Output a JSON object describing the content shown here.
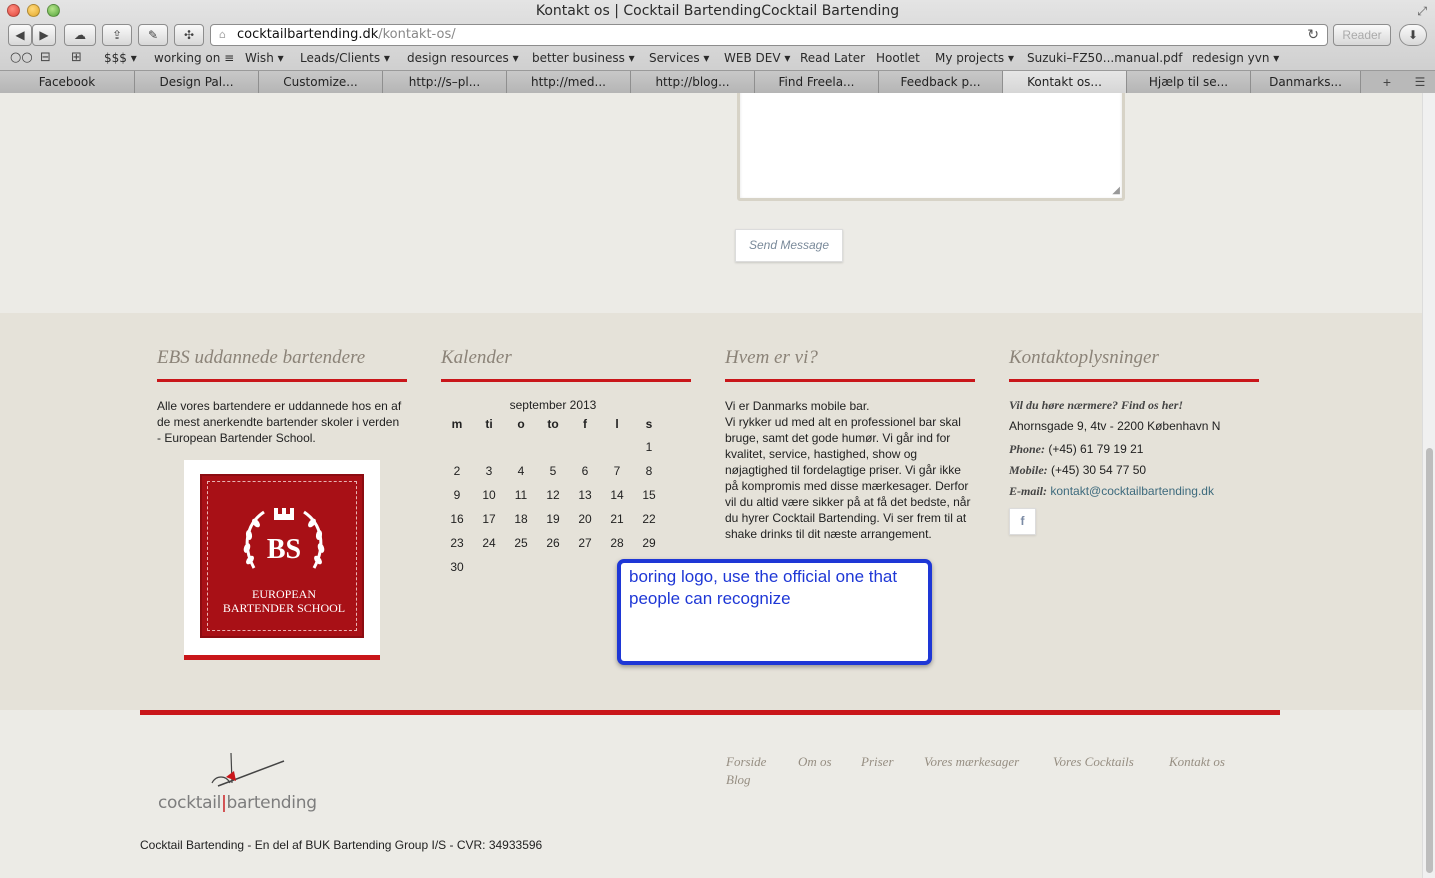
{
  "window": {
    "title": "Kontakt os | Cocktail BartendingCocktail Bartending"
  },
  "toolbar": {
    "url_host": "cocktailbartending.dk",
    "url_path": "/kontakt-os/",
    "reader_label": "Reader"
  },
  "bookmarks": [
    {
      "label": "$$$ ▾"
    },
    {
      "label": "working on ≡"
    },
    {
      "label": "Wish ▾"
    },
    {
      "label": "Leads/Clients ▾"
    },
    {
      "label": "design resources ▾"
    },
    {
      "label": "better business ▾"
    },
    {
      "label": "Services ▾"
    },
    {
      "label": "WEB DEV ▾"
    },
    {
      "label": "Read Later"
    },
    {
      "label": "Hootlet"
    },
    {
      "label": "My projects ▾"
    },
    {
      "label": "Suzuki–FZ50...manual.pdf"
    },
    {
      "label": "redesign yvn ▾"
    }
  ],
  "tabs": [
    {
      "label": "Facebook"
    },
    {
      "label": "Design Pal..."
    },
    {
      "label": "Customize..."
    },
    {
      "label": "http://s–pl..."
    },
    {
      "label": "http://med..."
    },
    {
      "label": "http://blog..."
    },
    {
      "label": "Find Freela..."
    },
    {
      "label": "Feedback p..."
    },
    {
      "label": "Kontakt os..."
    },
    {
      "label": "Hjælp til se..."
    },
    {
      "label": "Danmarks..."
    }
  ],
  "form": {
    "send_label": "Send Message"
  },
  "widgets": {
    "ebs": {
      "title": "EBS uddannede bartendere",
      "lines": [
        "Alle vores bartendere er uddannede hos en af",
        "de mest anerkendte bartender skoler i verden",
        "- European Bartender School."
      ],
      "logo_text_1": "EUROPEAN",
      "logo_text_2": "BARTENDER SCHOOL",
      "logo_monogram": "BS"
    },
    "calendar": {
      "title": "Kalender",
      "month": "september 2013",
      "weekdays": [
        "m",
        "ti",
        "o",
        "to",
        "f",
        "l",
        "s"
      ],
      "weeks": [
        [
          "",
          "",
          "",
          "",
          "",
          "",
          "1"
        ],
        [
          "2",
          "3",
          "4",
          "5",
          "6",
          "7",
          "8"
        ],
        [
          "9",
          "10",
          "11",
          "12",
          "13",
          "14",
          "15"
        ],
        [
          "16",
          "17",
          "18",
          "19",
          "20",
          "21",
          "22"
        ],
        [
          "23",
          "24",
          "25",
          "26",
          "27",
          "28",
          "29"
        ],
        [
          "30",
          "",
          "",
          "",
          "",
          "",
          ""
        ]
      ]
    },
    "about": {
      "title": "Hvem er vi?",
      "lines": [
        "Vi er Danmarks mobile bar.",
        "Vi rykker ud med alt en professionel bar skal",
        "bruge, samt det gode humør. Vi går ind for",
        "kvalitet, service, hastighed, show og",
        "nøjagtighed til fordelagtige priser. Vi går ikke",
        "på kompromis med disse mærkesager. Derfor",
        "vil du altid være sikker på at få det bedste, når",
        "du hyrer Cocktail Bartending. Vi ser frem til at",
        "shake drinks til dit næste arrangement."
      ]
    },
    "contact": {
      "title": "Kontaktoplysninger",
      "tagline": "Vil du høre nærmere? Find os her!",
      "address": "Ahornsgade 9, 4tv - 2200 København N",
      "phone_label": "Phone:",
      "phone": "(+45) 61 79 19 21",
      "mobile_label": "Mobile:",
      "mobile": "(+45) 30 54 77 50",
      "email_label": "E-mail:",
      "email": "kontakt@cocktailbartending.dk",
      "facebook_glyph": "f"
    }
  },
  "annotation": {
    "text": "boring logo, use the official one that people can recognize"
  },
  "footer": {
    "logo_word_1": "cocktail",
    "logo_word_2": "bartending",
    "copyright": "Cocktail Bartending - En del af BUK Bartending Group I/S - CVR: 34933596",
    "nav": [
      "Forside",
      "Om os",
      "Priser",
      "Vores mærkesager",
      "Vores Cocktails",
      "Kontakt os",
      "Blog"
    ]
  },
  "colors": {
    "accent_red": "#c9161a",
    "annotation_blue": "#1e37d6"
  }
}
